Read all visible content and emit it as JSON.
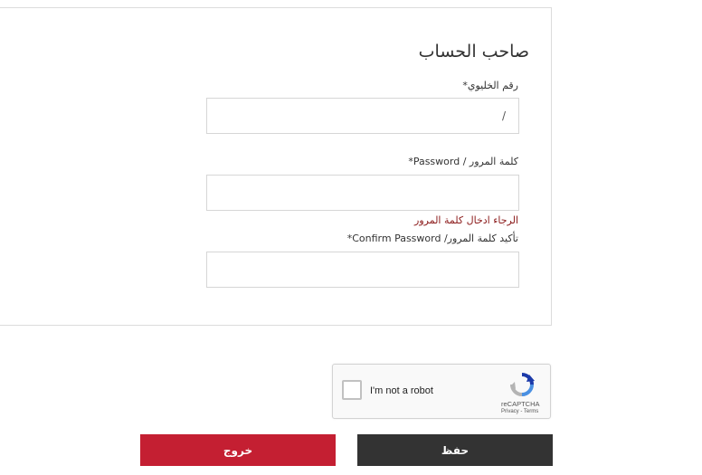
{
  "account": {
    "title": "صاحب الحساب",
    "gulf_id_label": "رقم الخليوي*",
    "gulf_id_value": "/",
    "password_label": "كلمة المرور / Password*",
    "password_value": "",
    "password_error": "الرجاء ادخال كلمة المرور",
    "confirm_label": "تأكيد كلمة المرور/ Confirm Password*",
    "confirm_value": ""
  },
  "captcha": {
    "label": "I'm not a robot",
    "brand": "reCAPTCHA",
    "legal": "Privacy - Terms"
  },
  "actions": {
    "exit_label": "خروج",
    "save_label": "حفظ"
  },
  "colors": {
    "exit": "#c41f32",
    "save": "#333333",
    "error": "#8b1a1a"
  }
}
